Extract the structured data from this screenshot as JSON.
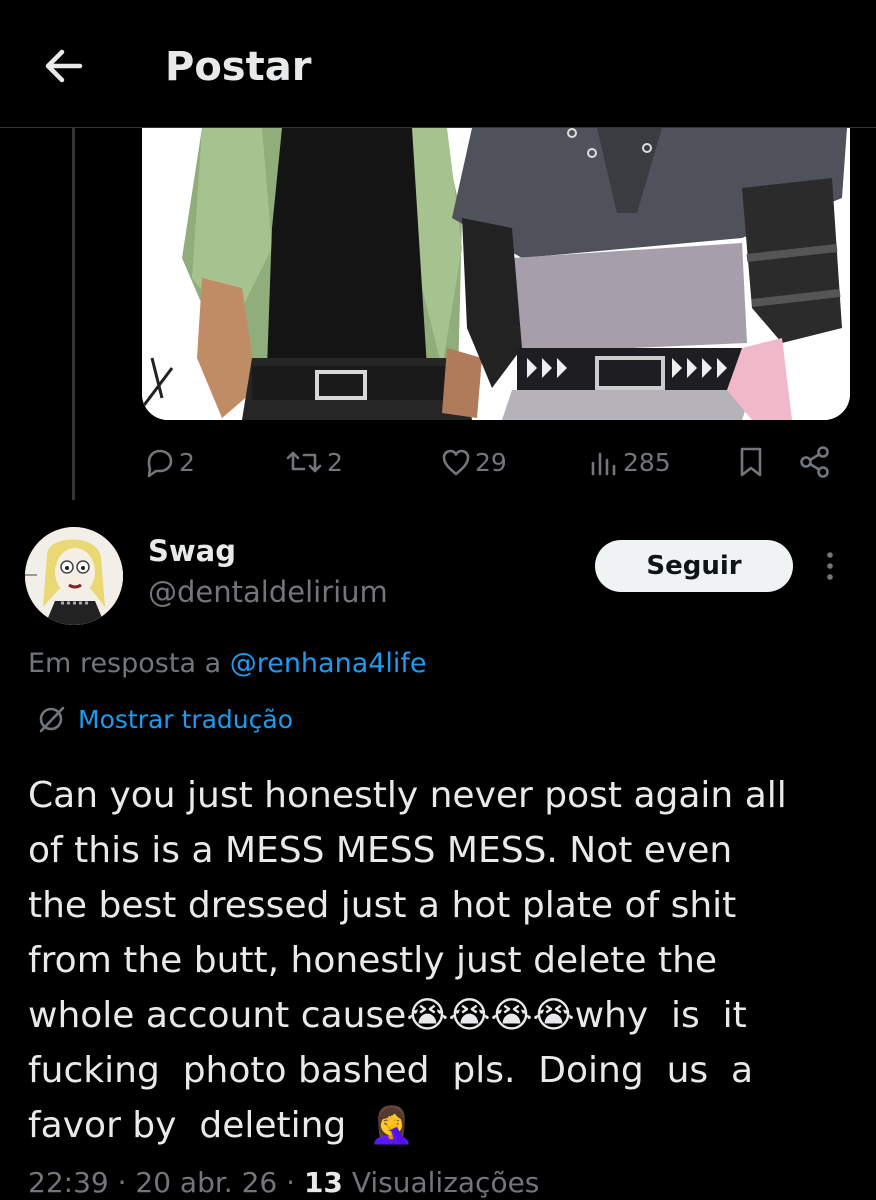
{
  "header": {
    "title": "Postar",
    "back_icon": "arrow-left-icon"
  },
  "parent_post": {
    "actions": {
      "replies": "2",
      "reposts": "2",
      "likes": "29",
      "views": "285"
    }
  },
  "post": {
    "author": {
      "name": "Swag",
      "handle": "@dentaldelirium"
    },
    "follow_label": "Seguir",
    "reply_prefix": "Em resposta a ",
    "reply_mention": "@renhana4life",
    "translate_label": "Mostrar tradução",
    "text": "Can you just honestly never post again all\nof this is a MESS MESS MESS. Not even\nthe best dressed just a hot plate of shit\nfrom the butt, honestly just delete the\nwhole account cause😭😭😭😭why  is  it\nfucking  photo bashed  pls.  Doing  us  a\nfavor by  deleting  🤦‍♀️",
    "time": "22:39",
    "date": "20 abr. 26",
    "views_count": "13",
    "views_label": "Visualizações"
  },
  "colors": {
    "background": "#000000",
    "text": "#e7e9ea",
    "muted": "#71767b",
    "accent": "#1d9bf0",
    "divider": "#2f3336"
  }
}
